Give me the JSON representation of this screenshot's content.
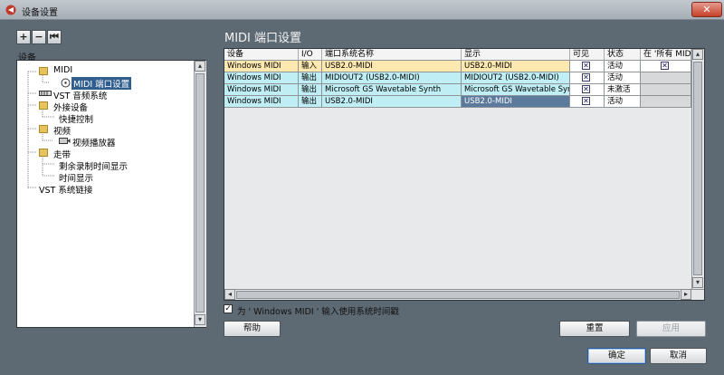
{
  "window": {
    "title": "设备设置",
    "close_label": "✕"
  },
  "toolbar": {
    "add_label": "+",
    "remove_label": "−",
    "reset_label": "⏮"
  },
  "left": {
    "header": "设备",
    "tree": [
      {
        "label": "MIDI",
        "icon": "folder-icon"
      },
      {
        "label": "MIDI 端口设置",
        "icon": "midi-port-icon",
        "selected": true
      },
      {
        "label": "VST 音频系统",
        "icon": "audio-device-icon"
      },
      {
        "label": "外接设备",
        "icon": "folder-icon"
      },
      {
        "label": "快捷控制",
        "icon": ""
      },
      {
        "label": "视频",
        "icon": "folder-icon"
      },
      {
        "label": "视频播放器",
        "icon": "video-device-icon"
      },
      {
        "label": "走带",
        "icon": "folder-icon"
      },
      {
        "label": "剩余录制时间显示",
        "icon": ""
      },
      {
        "label": "时间显示",
        "icon": ""
      },
      {
        "label": "VST 系统链接",
        "icon": ""
      }
    ]
  },
  "right": {
    "title": "MIDI 端口设置",
    "columns": [
      "设备",
      "I/O",
      "端口系统名称",
      "显示",
      "可见",
      "状态",
      "在 '所有 MIDI"
    ],
    "rows": [
      {
        "device": "Windows MIDI",
        "io": "输入",
        "system_name": "USB2.0-MIDI",
        "display": "USB2.0-MIDI",
        "visible": "✕",
        "state": "活动",
        "all_midi": "✕"
      },
      {
        "device": "Windows MIDI",
        "io": "输出",
        "system_name": "MIDIOUT2 (USB2.0-MIDI)",
        "display": "MIDIOUT2 (USB2.0-MIDI)",
        "visible": "✕",
        "state": "活动",
        "all_midi": ""
      },
      {
        "device": "Windows MIDI",
        "io": "输出",
        "system_name": "Microsoft GS Wavetable Synth",
        "display": "Microsoft GS Wavetable Synth",
        "visible": "✕",
        "state": "未激活",
        "all_midi": ""
      },
      {
        "device": "Windows MIDI",
        "io": "输出",
        "system_name": "USB2.0-MIDI",
        "display": "USB2.0-MIDI",
        "visible": "✕",
        "state": "活动",
        "all_midi": ""
      }
    ],
    "checkbox_label": "为 ' Windows MIDI ' 输入使用系统时间戳",
    "checkbox_checked": "✓"
  },
  "buttons": {
    "help": "帮助",
    "reset": "重置",
    "apply": "应用",
    "ok": "确定",
    "cancel": "取消"
  },
  "colors": {
    "input_row": "#fde9b0",
    "output_row": "#bfeef4",
    "selected_display": "#5b7a9c",
    "inactive_cell": "#d6d8da"
  }
}
